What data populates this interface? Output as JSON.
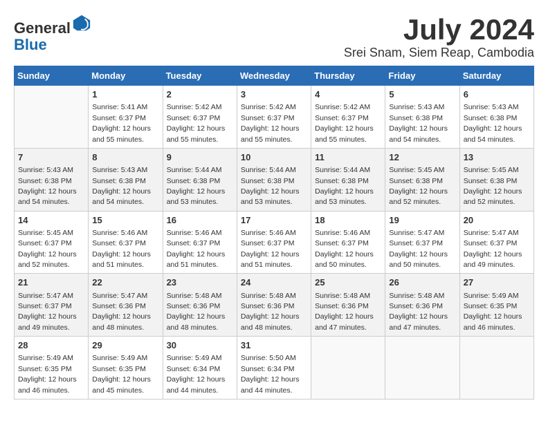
{
  "header": {
    "logo_line1": "General",
    "logo_line2": "Blue",
    "month_title": "July 2024",
    "location": "Srei Snam, Siem Reap, Cambodia"
  },
  "weekdays": [
    "Sunday",
    "Monday",
    "Tuesday",
    "Wednesday",
    "Thursday",
    "Friday",
    "Saturday"
  ],
  "weeks": [
    [
      {
        "day": "",
        "empty": true
      },
      {
        "day": "1",
        "sunrise": "5:41 AM",
        "sunset": "6:37 PM",
        "daylight": "12 hours and 55 minutes."
      },
      {
        "day": "2",
        "sunrise": "5:42 AM",
        "sunset": "6:37 PM",
        "daylight": "12 hours and 55 minutes."
      },
      {
        "day": "3",
        "sunrise": "5:42 AM",
        "sunset": "6:37 PM",
        "daylight": "12 hours and 55 minutes."
      },
      {
        "day": "4",
        "sunrise": "5:42 AM",
        "sunset": "6:37 PM",
        "daylight": "12 hours and 55 minutes."
      },
      {
        "day": "5",
        "sunrise": "5:43 AM",
        "sunset": "6:38 PM",
        "daylight": "12 hours and 54 minutes."
      },
      {
        "day": "6",
        "sunrise": "5:43 AM",
        "sunset": "6:38 PM",
        "daylight": "12 hours and 54 minutes."
      }
    ],
    [
      {
        "day": "7",
        "sunrise": "5:43 AM",
        "sunset": "6:38 PM",
        "daylight": "12 hours and 54 minutes."
      },
      {
        "day": "8",
        "sunrise": "5:43 AM",
        "sunset": "6:38 PM",
        "daylight": "12 hours and 54 minutes."
      },
      {
        "day": "9",
        "sunrise": "5:44 AM",
        "sunset": "6:38 PM",
        "daylight": "12 hours and 53 minutes."
      },
      {
        "day": "10",
        "sunrise": "5:44 AM",
        "sunset": "6:38 PM",
        "daylight": "12 hours and 53 minutes."
      },
      {
        "day": "11",
        "sunrise": "5:44 AM",
        "sunset": "6:38 PM",
        "daylight": "12 hours and 53 minutes."
      },
      {
        "day": "12",
        "sunrise": "5:45 AM",
        "sunset": "6:38 PM",
        "daylight": "12 hours and 52 minutes."
      },
      {
        "day": "13",
        "sunrise": "5:45 AM",
        "sunset": "6:38 PM",
        "daylight": "12 hours and 52 minutes."
      }
    ],
    [
      {
        "day": "14",
        "sunrise": "5:45 AM",
        "sunset": "6:37 PM",
        "daylight": "12 hours and 52 minutes."
      },
      {
        "day": "15",
        "sunrise": "5:46 AM",
        "sunset": "6:37 PM",
        "daylight": "12 hours and 51 minutes."
      },
      {
        "day": "16",
        "sunrise": "5:46 AM",
        "sunset": "6:37 PM",
        "daylight": "12 hours and 51 minutes."
      },
      {
        "day": "17",
        "sunrise": "5:46 AM",
        "sunset": "6:37 PM",
        "daylight": "12 hours and 51 minutes."
      },
      {
        "day": "18",
        "sunrise": "5:46 AM",
        "sunset": "6:37 PM",
        "daylight": "12 hours and 50 minutes."
      },
      {
        "day": "19",
        "sunrise": "5:47 AM",
        "sunset": "6:37 PM",
        "daylight": "12 hours and 50 minutes."
      },
      {
        "day": "20",
        "sunrise": "5:47 AM",
        "sunset": "6:37 PM",
        "daylight": "12 hours and 49 minutes."
      }
    ],
    [
      {
        "day": "21",
        "sunrise": "5:47 AM",
        "sunset": "6:37 PM",
        "daylight": "12 hours and 49 minutes."
      },
      {
        "day": "22",
        "sunrise": "5:47 AM",
        "sunset": "6:36 PM",
        "daylight": "12 hours and 48 minutes."
      },
      {
        "day": "23",
        "sunrise": "5:48 AM",
        "sunset": "6:36 PM",
        "daylight": "12 hours and 48 minutes."
      },
      {
        "day": "24",
        "sunrise": "5:48 AM",
        "sunset": "6:36 PM",
        "daylight": "12 hours and 48 minutes."
      },
      {
        "day": "25",
        "sunrise": "5:48 AM",
        "sunset": "6:36 PM",
        "daylight": "12 hours and 47 minutes."
      },
      {
        "day": "26",
        "sunrise": "5:48 AM",
        "sunset": "6:36 PM",
        "daylight": "12 hours and 47 minutes."
      },
      {
        "day": "27",
        "sunrise": "5:49 AM",
        "sunset": "6:35 PM",
        "daylight": "12 hours and 46 minutes."
      }
    ],
    [
      {
        "day": "28",
        "sunrise": "5:49 AM",
        "sunset": "6:35 PM",
        "daylight": "12 hours and 46 minutes."
      },
      {
        "day": "29",
        "sunrise": "5:49 AM",
        "sunset": "6:35 PM",
        "daylight": "12 hours and 45 minutes."
      },
      {
        "day": "30",
        "sunrise": "5:49 AM",
        "sunset": "6:34 PM",
        "daylight": "12 hours and 44 minutes."
      },
      {
        "day": "31",
        "sunrise": "5:50 AM",
        "sunset": "6:34 PM",
        "daylight": "12 hours and 44 minutes."
      },
      {
        "day": "",
        "empty": true
      },
      {
        "day": "",
        "empty": true
      },
      {
        "day": "",
        "empty": true
      }
    ]
  ]
}
